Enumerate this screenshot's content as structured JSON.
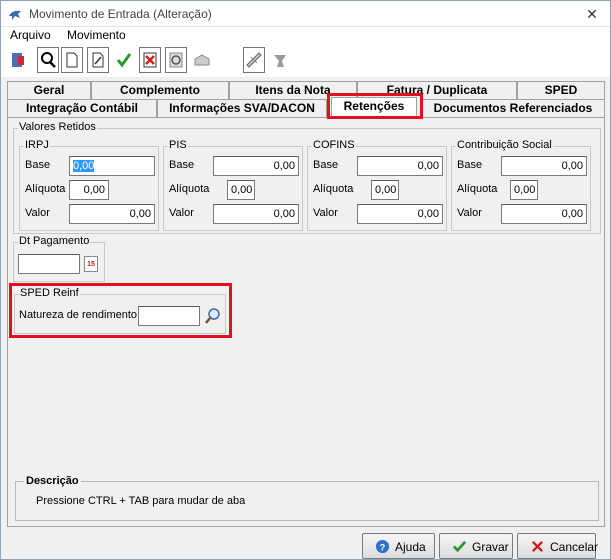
{
  "window": {
    "title": "Movimento de Entrada (Alteração)",
    "close_glyph": "✕"
  },
  "menu": {
    "items": [
      "Arquivo",
      "Movimento"
    ]
  },
  "toolbar": {
    "icons": [
      "exit-icon",
      "search-icon",
      "new-icon",
      "edit-icon",
      "confirm-icon",
      "delete-icon",
      "refresh-icon",
      "cancel-icon",
      "tax-calc-icon",
      "stamp-icon"
    ]
  },
  "tabs": {
    "row1": [
      "Geral",
      "Complemento",
      "Itens da Nota",
      "Fatura / Duplicata",
      "SPED"
    ],
    "row2": [
      "Integração Contábil",
      "Informações SVA/DACON",
      "Retenções",
      "Documentos Referenciados"
    ],
    "active": "Retenções"
  },
  "valores_retidos": {
    "title": "Valores Retidos",
    "groups": [
      {
        "name": "IRPJ",
        "base_label": "Base",
        "base": "0,00",
        "aliq_label": "Alíquota",
        "aliq": "0,00",
        "valor_label": "Valor",
        "valor": "0,00"
      },
      {
        "name": "PIS",
        "base_label": "Base",
        "base": "0,00",
        "aliq_label": "Alíquota",
        "aliq": "0,00",
        "valor_label": "Valor",
        "valor": "0,00"
      },
      {
        "name": "COFINS",
        "base_label": "Base",
        "base": "0,00",
        "aliq_label": "Alíquota",
        "aliq": "0,00",
        "valor_label": "Valor",
        "valor": "0,00"
      },
      {
        "name": "Contribuição Social",
        "base_label": "Base",
        "base": "0,00",
        "aliq_label": "Alíquota",
        "aliq": "0,00",
        "valor_label": "Valor",
        "valor": "0,00"
      }
    ]
  },
  "dt_pagamento": {
    "label": "Dt Pagamento",
    "value": "",
    "calendar_glyph": "15"
  },
  "sped_reinf": {
    "title": "SPED Reinf",
    "natureza_label": "Natureza de rendimento",
    "natureza_value": ""
  },
  "descricao": {
    "title": "Descrição",
    "text": "Pressione CTRL + TAB para  mudar de aba"
  },
  "buttons": {
    "ajuda": "Ajuda",
    "gravar": "Gravar",
    "cancelar": "Cancelar"
  },
  "colors": {
    "highlight": "#e01020",
    "selection": "#3399ff"
  }
}
